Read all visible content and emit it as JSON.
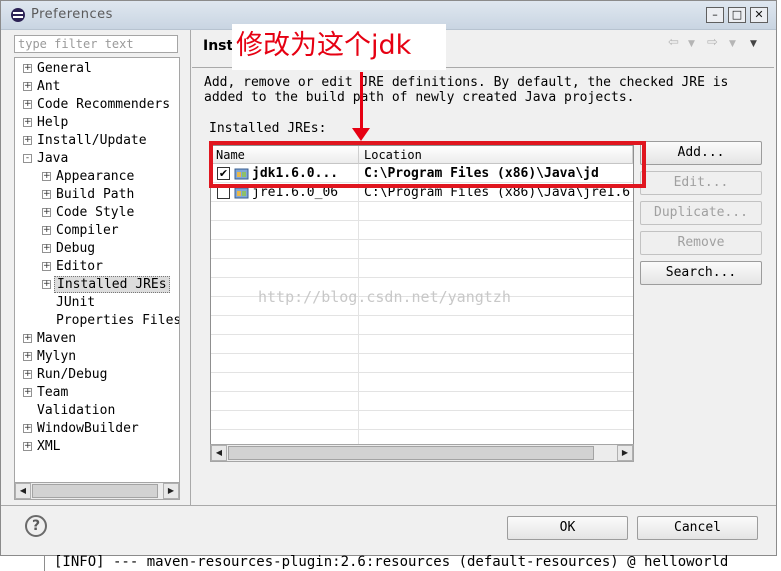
{
  "window": {
    "title": "Preferences"
  },
  "filter": {
    "placeholder": "type filter text"
  },
  "tree": {
    "items": [
      {
        "label": "General",
        "level": 0,
        "expander": "+"
      },
      {
        "label": "Ant",
        "level": 0,
        "expander": "+"
      },
      {
        "label": "Code Recommenders",
        "level": 0,
        "expander": "+"
      },
      {
        "label": "Help",
        "level": 0,
        "expander": "+"
      },
      {
        "label": "Install/Update",
        "level": 0,
        "expander": "+"
      },
      {
        "label": "Java",
        "level": 0,
        "expander": "-"
      },
      {
        "label": "Appearance",
        "level": 1,
        "expander": "+"
      },
      {
        "label": "Build Path",
        "level": 1,
        "expander": "+"
      },
      {
        "label": "Code Style",
        "level": 1,
        "expander": "+"
      },
      {
        "label": "Compiler",
        "level": 1,
        "expander": "+"
      },
      {
        "label": "Debug",
        "level": 1,
        "expander": "+"
      },
      {
        "label": "Editor",
        "level": 1,
        "expander": "+"
      },
      {
        "label": "Installed JREs",
        "level": 1,
        "expander": "+",
        "selected": true
      },
      {
        "label": "JUnit",
        "level": 1,
        "expander": ""
      },
      {
        "label": "Properties Files",
        "level": 1,
        "expander": ""
      },
      {
        "label": "Maven",
        "level": 0,
        "expander": "+"
      },
      {
        "label": "Mylyn",
        "level": 0,
        "expander": "+"
      },
      {
        "label": "Run/Debug",
        "level": 0,
        "expander": "+"
      },
      {
        "label": "Team",
        "level": 0,
        "expander": "+"
      },
      {
        "label": "Validation",
        "level": 0,
        "expander": ""
      },
      {
        "label": "WindowBuilder",
        "level": 0,
        "expander": "+"
      },
      {
        "label": "XML",
        "level": 0,
        "expander": "+"
      }
    ]
  },
  "page": {
    "title": "Installed JREs",
    "description": "Add, remove or edit JRE definitions. By default, the checked JRE is added to the build path of newly created Java projects.",
    "installed_label": "Installed JREs:"
  },
  "table": {
    "columns": [
      "Name",
      "Location"
    ],
    "rows": [
      {
        "checked": true,
        "name": "jdk1.6.0...",
        "location": "C:\\Program Files (x86)\\Java\\jd"
      },
      {
        "checked": false,
        "name": "jre1.6.0_06",
        "location": "C:\\Program Files (x86)\\Java\\jre1.6"
      }
    ]
  },
  "buttons": {
    "add": "Add...",
    "edit": "Edit...",
    "duplicate": "Duplicate...",
    "remove": "Remove",
    "search": "Search...",
    "ok": "OK",
    "cancel": "Cancel"
  },
  "annotation": {
    "text": "修改为这个jdk",
    "color": "#e60012"
  },
  "watermark": "http://blog.csdn.net/yangtzh",
  "console": {
    "text": "[INFO] --- maven-resources-plugin:2.6:resources (default-resources) @ helloworld"
  }
}
